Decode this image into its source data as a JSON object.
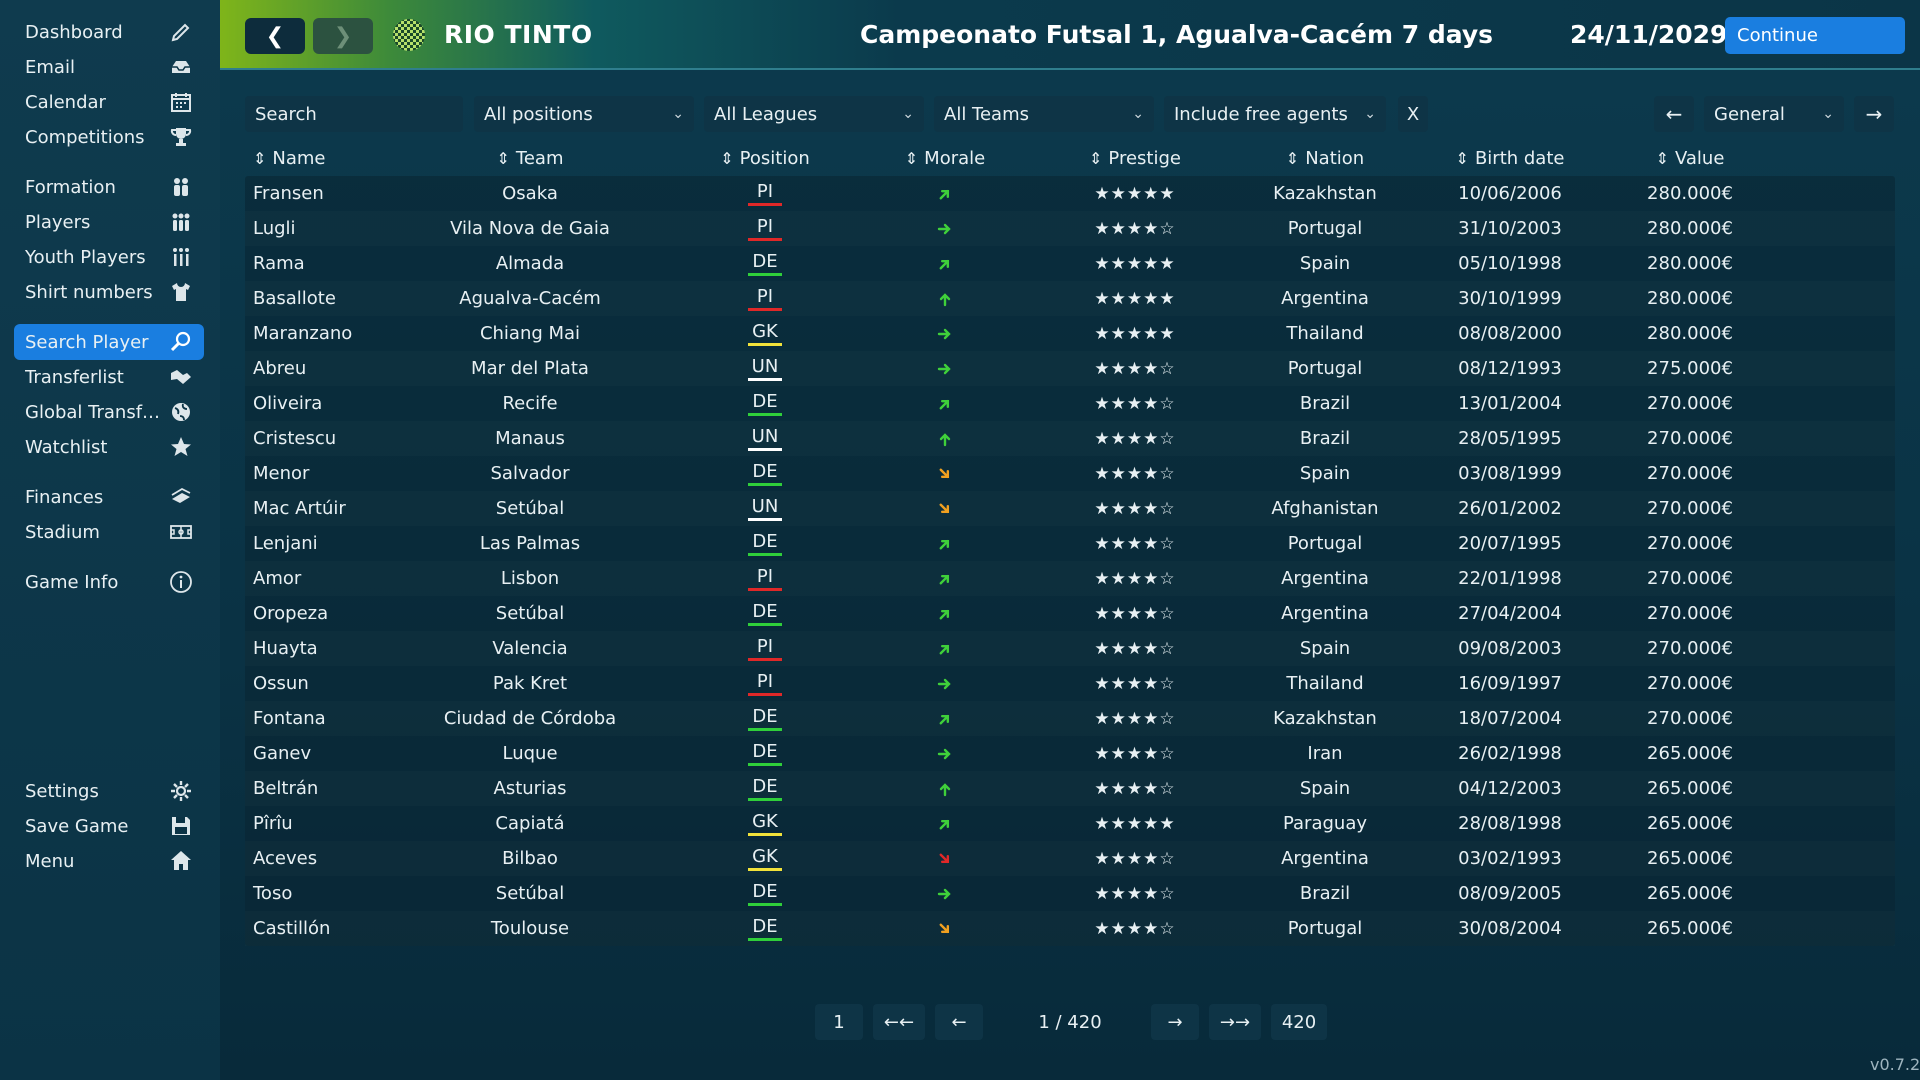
{
  "sidebar": {
    "items": [
      {
        "label": "Dashboard",
        "icon": "pencil-icon",
        "active": false
      },
      {
        "label": "Email",
        "icon": "inbox-icon",
        "active": false
      },
      {
        "label": "Calendar",
        "icon": "calendar-icon",
        "active": false
      },
      {
        "label": "Competitions",
        "icon": "trophy-icon",
        "active": false
      },
      {
        "label": "Formation",
        "icon": "formation-icon",
        "active": false
      },
      {
        "label": "Players",
        "icon": "players-icon",
        "active": false
      },
      {
        "label": "Youth Players",
        "icon": "youth-players-icon",
        "active": false
      },
      {
        "label": "Shirt numbers",
        "icon": "shirt-icon",
        "active": false
      },
      {
        "label": "Search Player",
        "icon": "search-icon",
        "active": true
      },
      {
        "label": "Transferlist",
        "icon": "handshake-icon",
        "active": false
      },
      {
        "label": "Global Transfe...",
        "icon": "globe-icon",
        "active": false
      },
      {
        "label": "Watchlist",
        "icon": "star-icon",
        "active": false
      },
      {
        "label": "Finances",
        "icon": "money-icon",
        "active": false
      },
      {
        "label": "Stadium",
        "icon": "stadium-icon",
        "active": false
      },
      {
        "label": "Game Info",
        "icon": "info-icon",
        "active": false
      },
      {
        "label": "Settings",
        "icon": "gear-icon",
        "active": false
      },
      {
        "label": "Save Game",
        "icon": "save-icon",
        "active": false
      },
      {
        "label": "Menu",
        "icon": "home-icon",
        "active": false
      }
    ]
  },
  "header": {
    "back_label": "❮",
    "forward_label": "❯",
    "club_name": "RIO TINTO",
    "match_info": "Campeonato Futsal 1, Agualva-Cacém 7 days",
    "date": "24/11/2029",
    "continue_label": "Continue"
  },
  "filters": {
    "search_placeholder": "Search",
    "positions": "All positions",
    "leagues": "All Leagues",
    "teams": "All Teams",
    "free_agents": "Include free agents",
    "clear_label": "X",
    "view_prev": "←",
    "view": "General",
    "view_next": "→"
  },
  "table": {
    "columns": [
      "Name",
      "Team",
      "Position",
      "Morale",
      "Prestige",
      "Nation",
      "Birth date",
      "Value"
    ],
    "rows": [
      {
        "name": "Fransen",
        "team": "Osaka",
        "position": "PI",
        "morale": "up-right",
        "stars": 5,
        "nation": "Kazakhstan",
        "birth": "10/06/2006",
        "value": "280.000€"
      },
      {
        "name": "Lugli",
        "team": "Vila Nova de Gaia",
        "position": "PI",
        "morale": "right",
        "stars": 4,
        "nation": "Portugal",
        "birth": "31/10/2003",
        "value": "280.000€"
      },
      {
        "name": "Rama",
        "team": "Almada",
        "position": "DE",
        "morale": "up-right",
        "stars": 5,
        "nation": "Spain",
        "birth": "05/10/1998",
        "value": "280.000€"
      },
      {
        "name": "Basallote",
        "team": "Agualva-Cacém",
        "position": "PI",
        "morale": "up",
        "stars": 5,
        "nation": "Argentina",
        "birth": "30/10/1999",
        "value": "280.000€"
      },
      {
        "name": "Maranzano",
        "team": "Chiang Mai",
        "position": "GK",
        "morale": "right",
        "stars": 5,
        "nation": "Thailand",
        "birth": "08/08/2000",
        "value": "280.000€"
      },
      {
        "name": "Abreu",
        "team": "Mar del Plata",
        "position": "UN",
        "morale": "right",
        "stars": 4,
        "nation": "Portugal",
        "birth": "08/12/1993",
        "value": "275.000€"
      },
      {
        "name": "Oliveira",
        "team": "Recife",
        "position": "DE",
        "morale": "up-right",
        "stars": 4,
        "nation": "Brazil",
        "birth": "13/01/2004",
        "value": "270.000€"
      },
      {
        "name": "Cristescu",
        "team": "Manaus",
        "position": "UN",
        "morale": "up",
        "stars": 4,
        "nation": "Brazil",
        "birth": "28/05/1995",
        "value": "270.000€"
      },
      {
        "name": "Menor",
        "team": "Salvador",
        "position": "DE",
        "morale": "down-right",
        "stars": 4,
        "nation": "Spain",
        "birth": "03/08/1999",
        "value": "270.000€"
      },
      {
        "name": "Mac Artúir",
        "team": "Setúbal",
        "position": "UN",
        "morale": "down-right",
        "stars": 4,
        "nation": "Afghanistan",
        "birth": "26/01/2002",
        "value": "270.000€"
      },
      {
        "name": "Lenjani",
        "team": "Las Palmas",
        "position": "DE",
        "morale": "up-right",
        "stars": 4,
        "nation": "Portugal",
        "birth": "20/07/1995",
        "value": "270.000€"
      },
      {
        "name": "Amor",
        "team": "Lisbon",
        "position": "PI",
        "morale": "up-right",
        "stars": 4,
        "nation": "Argentina",
        "birth": "22/01/1998",
        "value": "270.000€"
      },
      {
        "name": "Oropeza",
        "team": "Setúbal",
        "position": "DE",
        "morale": "up-right",
        "stars": 4,
        "nation": "Argentina",
        "birth": "27/04/2004",
        "value": "270.000€"
      },
      {
        "name": "Huayta",
        "team": "Valencia",
        "position": "PI",
        "morale": "up-right",
        "stars": 4,
        "nation": "Spain",
        "birth": "09/08/2003",
        "value": "270.000€"
      },
      {
        "name": "Ossun",
        "team": "Pak Kret",
        "position": "PI",
        "morale": "right",
        "stars": 4,
        "nation": "Thailand",
        "birth": "16/09/1997",
        "value": "270.000€"
      },
      {
        "name": "Fontana",
        "team": "Ciudad de Córdoba",
        "position": "DE",
        "morale": "up-right",
        "stars": 4,
        "nation": "Kazakhstan",
        "birth": "18/07/2004",
        "value": "270.000€"
      },
      {
        "name": "Ganev",
        "team": "Luque",
        "position": "DE",
        "morale": "right",
        "stars": 4,
        "nation": "Iran",
        "birth": "26/02/1998",
        "value": "265.000€"
      },
      {
        "name": "Beltrán",
        "team": "Asturias",
        "position": "DE",
        "morale": "up",
        "stars": 4,
        "nation": "Spain",
        "birth": "04/12/2003",
        "value": "265.000€"
      },
      {
        "name": "Pîrîu",
        "team": "Capiatá",
        "position": "GK",
        "morale": "up-right",
        "stars": 5,
        "nation": "Paraguay",
        "birth": "28/08/1998",
        "value": "265.000€"
      },
      {
        "name": "Aceves",
        "team": "Bilbao",
        "position": "GK",
        "morale": "down-right-red",
        "stars": 4,
        "nation": "Argentina",
        "birth": "03/02/1993",
        "value": "265.000€"
      },
      {
        "name": "Toso",
        "team": "Setúbal",
        "position": "DE",
        "morale": "right",
        "stars": 4,
        "nation": "Brazil",
        "birth": "08/09/2005",
        "value": "265.000€"
      },
      {
        "name": "Castillón",
        "team": "Toulouse",
        "position": "DE",
        "morale": "down-right",
        "stars": 4,
        "nation": "Portugal",
        "birth": "30/08/2004",
        "value": "265.000€"
      }
    ]
  },
  "pagination": {
    "first_page": "1",
    "first_label": "←←",
    "prev_label": "←",
    "indicator": "1 / 420",
    "next_label": "→",
    "last_label": "→→",
    "last_page": "420"
  },
  "version": "v0.7.2",
  "colors": {
    "accent": "#1a7ee0",
    "pos_PI": "#e02828",
    "pos_DE": "#2fcf3a",
    "pos_GK": "#f2e23a",
    "pos_UN": "#ffffff",
    "morale_green": "#3fd03a",
    "morale_orange": "#f0a020",
    "morale_red": "#e02828"
  }
}
